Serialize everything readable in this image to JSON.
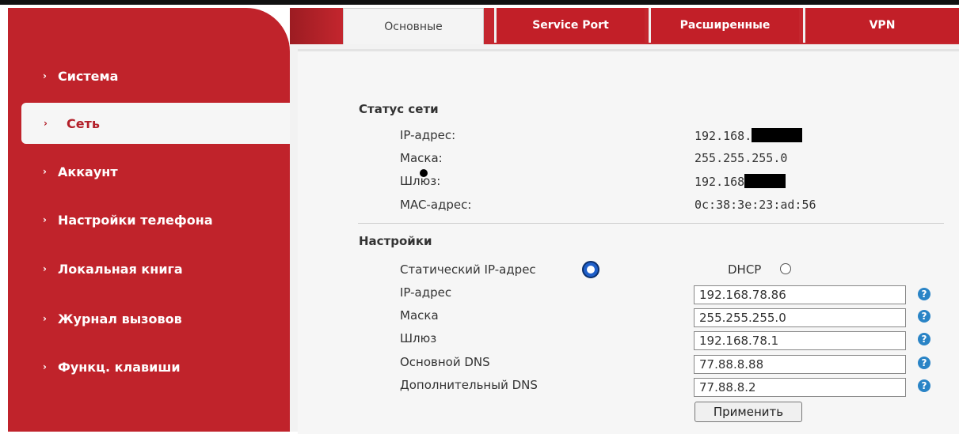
{
  "sidebar": {
    "items": [
      {
        "label": "Система",
        "active": false
      },
      {
        "label": "Сеть",
        "active": true
      },
      {
        "label": "Аккаунт",
        "active": false
      },
      {
        "label": "Настройки телефона",
        "active": false
      },
      {
        "label": "Локальная книга",
        "active": false
      },
      {
        "label": "Журнал вызовов",
        "active": false
      },
      {
        "label": "Функц. клавиши",
        "active": false
      }
    ],
    "chevron": "›"
  },
  "tabs": [
    {
      "label": "Основные",
      "active": true
    },
    {
      "label": "Service Port",
      "active": false
    },
    {
      "label": "Расширенные",
      "active": false
    },
    {
      "label": "VPN",
      "active": false
    }
  ],
  "status": {
    "title": "Статус сети",
    "rows": [
      {
        "label": "IP-адрес:",
        "value": "192.168."
      },
      {
        "label": "Маска:",
        "value": "255.255.255.0"
      },
      {
        "label": "Шлюз:",
        "value": "192.168"
      },
      {
        "label": "MAC-адрес:",
        "value": "0c:38:3e:23:ad:56"
      }
    ]
  },
  "settings": {
    "title": "Настройки",
    "static_label": "Статический IP-адрес",
    "static_selected": true,
    "dhcp_label": "DHCP",
    "dhcp_selected": false,
    "fields": [
      {
        "label": "IP-адрес",
        "value": "192.168.78.86"
      },
      {
        "label": "Маска",
        "value": "255.255.255.0"
      },
      {
        "label": "Шлюз",
        "value": "192.168.78.1"
      },
      {
        "label": "Основной DNS",
        "value": "77.88.8.88"
      },
      {
        "label": "Дополнительный DNS",
        "value": "77.88.8.2"
      }
    ],
    "help_glyph": "?",
    "apply_label": "Применить"
  },
  "colors": {
    "brand_red": "#c0232b",
    "help_blue": "#2a84c6",
    "radio_blue": "#1f5fc9"
  }
}
